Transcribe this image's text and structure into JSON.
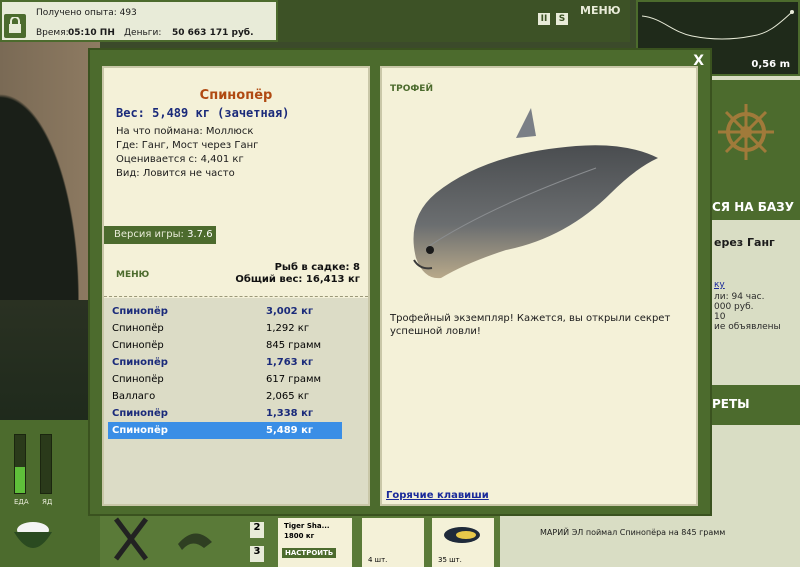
{
  "hud": {
    "experience": "Получено опыта: 493",
    "time_label": "Время:",
    "time_value": "05:10 ПН",
    "money_label": "Деньги:",
    "money_value": "50 663 171 руб.",
    "menu_label": "МЕНЮ",
    "pause_icon": "II",
    "sound_icon": "S",
    "depth": "0,56 m"
  },
  "side_panel": {
    "go_to_base": "СЯ НА БАЗУ",
    "location": "ерез Ганг",
    "link": "ку",
    "line1": "ли: 94 час.",
    "line2": "000 руб.",
    "line3": "10",
    "line4": "ие объявлены",
    "records": "РЕТЫ",
    "news": "МАРИЙ ЭЛ поймал Спинопёра на 845 грамм"
  },
  "bottom": {
    "food_label": "ЕДА",
    "poison_label": "ЯД",
    "slot2": "2",
    "slot3": "3",
    "tackle_name": "Tiger Sha...",
    "tackle_weight": "1800 кг",
    "configure": "НАСТРОИТЬ",
    "bait_count_1": "4 шт.",
    "bait_count_2": "35 шт."
  },
  "dialog": {
    "close": "X",
    "fish_name": "Спинопёр",
    "weight_line": "Вес: 5,489 кг (зачетная)",
    "caught_on": "На что поймана: Моллюск",
    "where": "Где: Ганг, Мост через Ганг",
    "value": "Оценивается с: 4,401 кг",
    "kind": "Вид: Ловится не часто",
    "version_label": "Версия игры:",
    "version_value": "3.7.6",
    "menu": "МЕНЮ",
    "fish_in_keepnet": "Рыб в садке: 8",
    "total_weight": "Общий вес: 16,413 кг",
    "catch_list": [
      {
        "name": "Спинопёр",
        "weight": "3,002 кг",
        "style": "bold"
      },
      {
        "name": "Спинопёр",
        "weight": "1,292 кг",
        "style": "normal"
      },
      {
        "name": "Спинопёр",
        "weight": "845 грамм",
        "style": "normal"
      },
      {
        "name": "Спинопёр",
        "weight": "1,763 кг",
        "style": "bold"
      },
      {
        "name": "Спинопёр",
        "weight": "617 грамм",
        "style": "normal"
      },
      {
        "name": "Валлаго",
        "weight": "2,065 кг",
        "style": "normal"
      },
      {
        "name": "Спинопёр",
        "weight": "1,338 кг",
        "style": "bold"
      },
      {
        "name": "Спинопёр",
        "weight": "5,489 кг",
        "style": "selected"
      }
    ],
    "trophy_label": "ТРОФЕЙ",
    "trophy_text": "Трофейный экземпляр! Кажется, вы открыли секрет успешной ловли!",
    "hotkeys": "Горячие клавиши"
  },
  "meters": {
    "food_level": 0.45,
    "poison_level": 0.0
  }
}
